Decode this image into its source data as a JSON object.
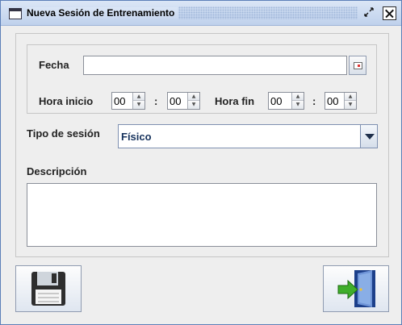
{
  "window": {
    "title": "Nueva Sesión de Entrenamiento"
  },
  "form": {
    "fecha_label": "Fecha",
    "fecha_value": "",
    "hora_inicio_label": "Hora inicio",
    "hora_inicio_h": "00",
    "hora_inicio_m": "00",
    "hora_fin_label": "Hora fin",
    "hora_fin_h": "00",
    "hora_fin_m": "00",
    "separator": ":",
    "tipo_label": "Tipo de sesión",
    "tipo_value": "Físico",
    "descripcion_label": "Descripción",
    "descripcion_value": ""
  },
  "icons": {
    "calendar": "calendar-icon",
    "save": "floppy-disk-icon",
    "exit": "exit-door-icon"
  }
}
